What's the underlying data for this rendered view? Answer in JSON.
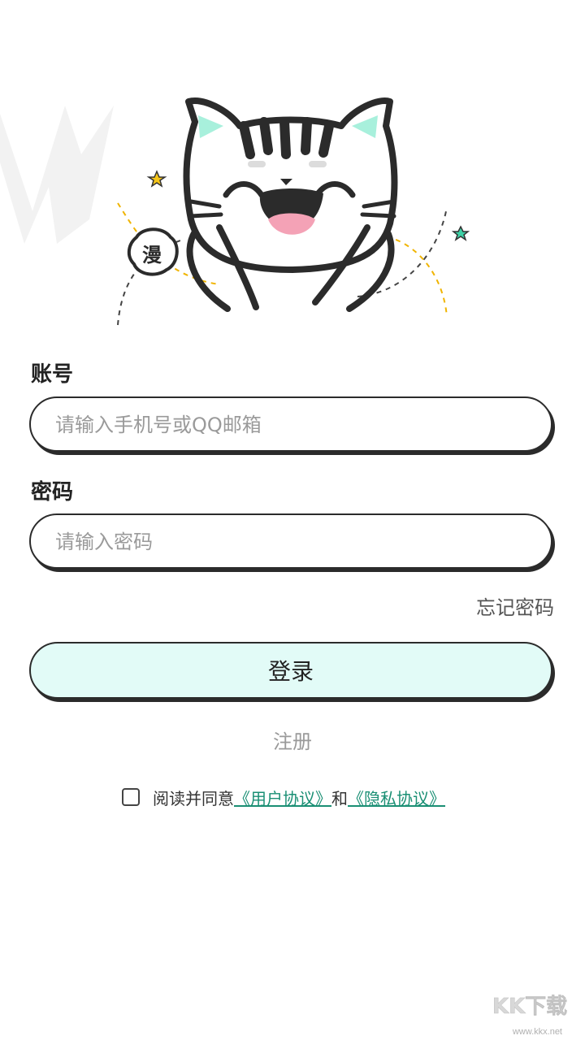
{
  "mascot": {
    "badge_char": "漫"
  },
  "form": {
    "account_label": "账号",
    "account_placeholder": "请输入手机号或QQ邮箱",
    "password_label": "密码",
    "password_placeholder": "请输入密码",
    "forgot_label": "忘记密码",
    "login_label": "登录",
    "register_label": "注册"
  },
  "agreement": {
    "checked": false,
    "prefix": "阅读并同意",
    "user_link": "《用户协议》",
    "conj": "和",
    "privacy_link": "《隐私协议》"
  },
  "watermark": {
    "text": "www.kkx.net",
    "brand": "KK下载"
  },
  "colors": {
    "accent_mint": "#e2fbf7",
    "link_green": "#1a8f74",
    "ear_mint": "#a8f0dc",
    "mouth_pink": "#f4a2b6"
  }
}
